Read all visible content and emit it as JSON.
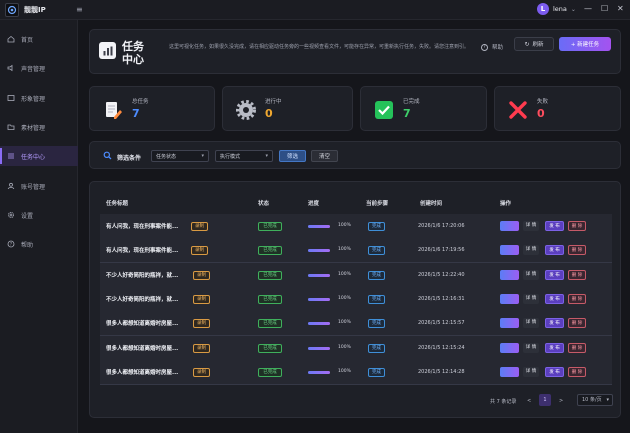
{
  "app": {
    "brand": "靓靓IP"
  },
  "user": {
    "initial": "L",
    "name": "lena"
  },
  "window": {
    "minimize": "—",
    "maximize": "☐",
    "close": "✕"
  },
  "sidebar": {
    "items": [
      {
        "label": "首页",
        "icon": "home-icon"
      },
      {
        "label": "声音管理",
        "icon": "speaker-icon"
      },
      {
        "label": "形象管理",
        "icon": "image-icon"
      },
      {
        "label": "素材管理",
        "icon": "folder-icon"
      },
      {
        "label": "任务中心",
        "icon": "list-icon",
        "active": true
      },
      {
        "label": "账号管理",
        "icon": "user-icon"
      },
      {
        "label": "设置",
        "icon": "gear-icon"
      },
      {
        "label": "帮助",
        "icon": "help-icon"
      }
    ]
  },
  "header": {
    "title": "任务中心",
    "description": "这里可视化任务，如果很久没完成，请在相应驱动任务旁的一些视频查看文件，可能存在异常，可重新执行任务，失败。请您注意到引。",
    "help_label": "帮助",
    "refresh_label": "刷新",
    "new_task_label": "+ 新建任务"
  },
  "stats": [
    {
      "label": "总任务",
      "value": "7",
      "color": "#4d8cff",
      "icon": "document-edit-icon"
    },
    {
      "label": "进行中",
      "value": "0",
      "color": "#f0a830",
      "icon": "gear-icon"
    },
    {
      "label": "已完成",
      "value": "7",
      "color": "#3ed06a",
      "icon": "check-icon"
    },
    {
      "label": "失败",
      "value": "0",
      "color": "#ff4d5e",
      "icon": "cross-icon"
    }
  ],
  "filter": {
    "label": "筛选条件",
    "status_select": "任务状态",
    "mode_select": "执行模式",
    "filter_button": "筛选",
    "clear_button": "清空"
  },
  "table": {
    "headers": [
      "任务标题",
      "状态",
      "进度",
      "当前步骤",
      "创建时间",
      "操作"
    ],
    "rows": [
      {
        "title": "有人问我，现在刑事案件能...",
        "type": "录制",
        "status": "已完成",
        "progress": 100,
        "progress_label": "100%",
        "step": "完成",
        "created": "2026/1/6 17:20:06"
      },
      {
        "title": "有人问我，现在刑事案件能...",
        "type": "录制",
        "status": "已完成",
        "progress": 100,
        "progress_label": "100%",
        "step": "完成",
        "created": "2026/1/6 17:19:56"
      },
      {
        "title": "不少人好奇简阳的瓶祥，就...",
        "type": "录制",
        "status": "已完成",
        "progress": 100,
        "progress_label": "100%",
        "step": "完成",
        "created": "2026/1/5 12:22:40"
      },
      {
        "title": "不少人好奇简阳的瓶祥，就...",
        "type": "录制",
        "status": "已完成",
        "progress": 100,
        "progress_label": "100%",
        "step": "完成",
        "created": "2026/1/5 12:16:31"
      },
      {
        "title": "很多人都想知道离婚时房屋...",
        "type": "录制",
        "status": "已完成",
        "progress": 100,
        "progress_label": "100%",
        "step": "完成",
        "created": "2026/1/5 12:15:57"
      },
      {
        "title": "很多人都想知道离婚时房屋...",
        "type": "录制",
        "status": "已完成",
        "progress": 100,
        "progress_label": "100%",
        "step": "完成",
        "created": "2026/1/5 12:15:24"
      },
      {
        "title": "很多人都想知道离婚时房屋...",
        "type": "录制",
        "status": "已完成",
        "progress": 100,
        "progress_label": "100%",
        "step": "完成",
        "created": "2026/1/5 12:14:28"
      }
    ],
    "actions": {
      "detail": "详 情",
      "publish": "发 布",
      "delete": "删 除"
    }
  },
  "pagination": {
    "total_label": "共 7 条记录",
    "prev": "<",
    "current_page": "1",
    "next": ">",
    "page_size": "10 条/页"
  }
}
